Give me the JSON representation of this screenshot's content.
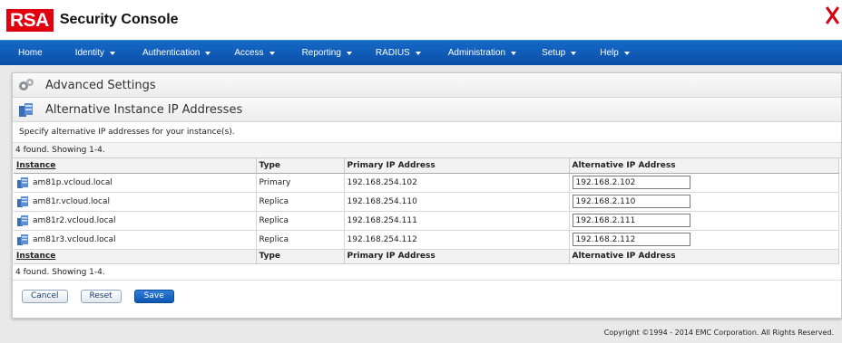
{
  "app": {
    "brand": "RSA",
    "title": "Security Console"
  },
  "nav": [
    {
      "label": "Home",
      "dropdown": false
    },
    {
      "label": "Identity",
      "dropdown": true
    },
    {
      "label": "Authentication",
      "dropdown": true
    },
    {
      "label": "Access",
      "dropdown": true
    },
    {
      "label": "Reporting",
      "dropdown": true
    },
    {
      "label": "RADIUS",
      "dropdown": true
    },
    {
      "label": "Administration",
      "dropdown": true
    },
    {
      "label": "Setup",
      "dropdown": true
    },
    {
      "label": "Help",
      "dropdown": true
    }
  ],
  "breadcrumb_title": "Advanced Settings",
  "page_title": "Alternative Instance IP Addresses",
  "description": "Specify alternative IP addresses for your instance(s).",
  "count_text": "4 found. Showing 1-4.",
  "columns": [
    "Instance",
    "Type",
    "Primary IP Address",
    "Alternative IP Address"
  ],
  "rows": [
    {
      "instance": "am81p.vcloud.local",
      "type": "Primary",
      "primary_ip": "192.168.254.102",
      "alt_ip": "192.168.2.102"
    },
    {
      "instance": "am81r.vcloud.local",
      "type": "Replica",
      "primary_ip": "192.168.254.110",
      "alt_ip": "192.168.2.110"
    },
    {
      "instance": "am81r2.vcloud.local",
      "type": "Replica",
      "primary_ip": "192.168.254.111",
      "alt_ip": "192.168.2.111"
    },
    {
      "instance": "am81r3.vcloud.local",
      "type": "Replica",
      "primary_ip": "192.168.254.112",
      "alt_ip": "192.168.2.112"
    }
  ],
  "buttons": {
    "cancel": "Cancel",
    "reset": "Reset",
    "save": "Save"
  },
  "copyright": "Copyright ©1994 - 2014 EMC Corporation. All Rights Reserved.",
  "colors": {
    "brand_red": "#e0000f",
    "nav_blue": "#1569c7",
    "primary_button": "#0d56b2"
  },
  "icons": {
    "settings": "gears-icon",
    "page": "server-stack-icon",
    "instance": "server-icon",
    "close": "close-icon"
  }
}
